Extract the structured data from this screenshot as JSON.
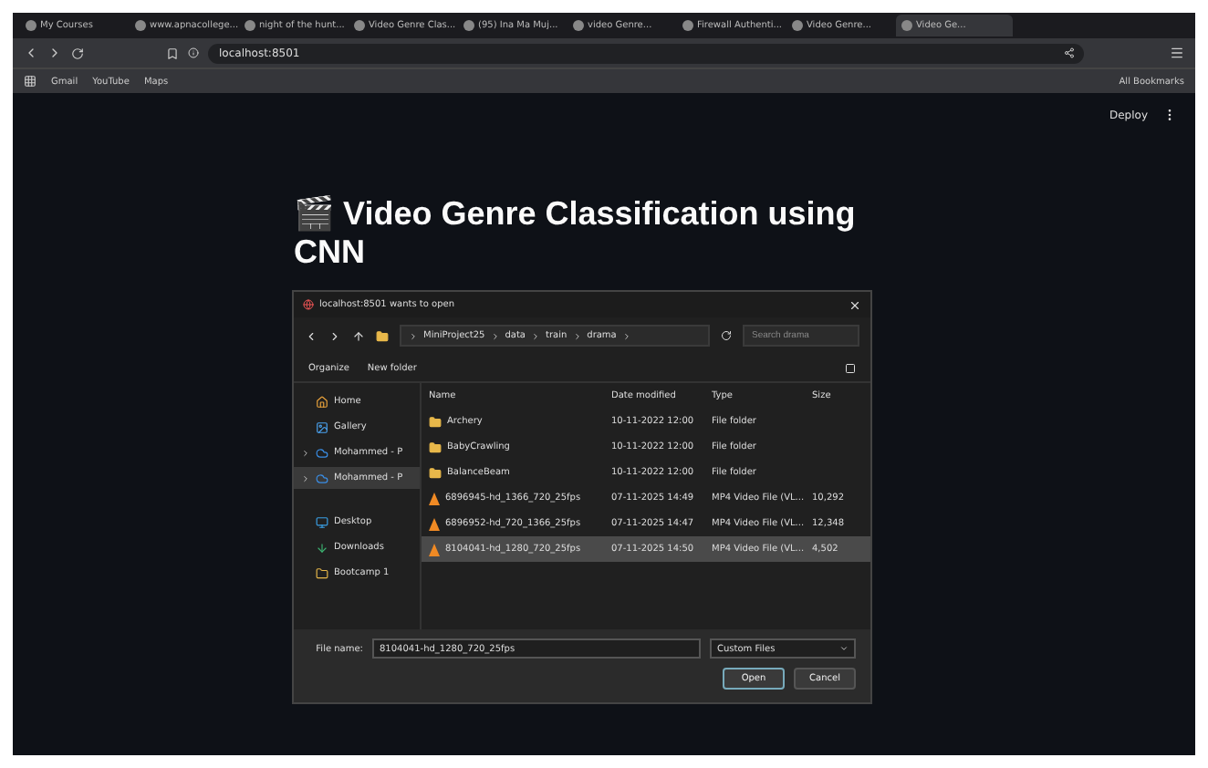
{
  "browser": {
    "tabs": [
      {
        "label": "My Courses",
        "selected": false
      },
      {
        "label": "www.apnacollege...",
        "selected": false
      },
      {
        "label": "night of the hunt...",
        "selected": false
      },
      {
        "label": "Video Genre Clas...",
        "selected": false
      },
      {
        "label": "(95) Ina Ma Muj...",
        "selected": false
      },
      {
        "label": "video Genre...",
        "selected": false
      },
      {
        "label": "Firewall Authenti...",
        "selected": false
      },
      {
        "label": "Video Genre...",
        "selected": false
      },
      {
        "label": "Video Ge...",
        "selected": true
      }
    ],
    "address": "localhost:8501",
    "bookmarks": [
      "Gmail",
      "YouTube",
      "Maps"
    ],
    "all_bookmarks": "All Bookmarks"
  },
  "app": {
    "deploy": "Deploy",
    "title_icon": "🎬",
    "title": "Video Genre Classification using CNN"
  },
  "dialog": {
    "title": "localhost:8501 wants to open",
    "path": [
      "MiniProject25",
      "data",
      "train",
      "drama"
    ],
    "search": {
      "placeholder": "Search drama"
    },
    "organize": "Organize",
    "new_folder": "New folder",
    "sidebar": [
      {
        "label": "Home",
        "kind": "home",
        "expandable": false,
        "selected": false
      },
      {
        "label": "Gallery",
        "kind": "gallery",
        "expandable": false,
        "selected": false
      },
      {
        "label": "Mohammed - P",
        "kind": "cloud",
        "expandable": true,
        "selected": false
      },
      {
        "label": "Mohammed - P",
        "kind": "cloud",
        "expandable": true,
        "selected": true
      },
      {
        "label": "Desktop",
        "kind": "desktop",
        "expandable": false,
        "selected": false
      },
      {
        "label": "Downloads",
        "kind": "download",
        "expandable": false,
        "selected": false
      },
      {
        "label": "Bootcamp 1",
        "kind": "folder",
        "expandable": false,
        "selected": false
      }
    ],
    "columns": [
      "Name",
      "Date modified",
      "Type",
      "Size"
    ],
    "files": [
      {
        "kind": "folder",
        "name": "Archery",
        "date": "10-11-2022 12:00",
        "type": "File folder",
        "selected": false
      },
      {
        "kind": "folder",
        "name": "BabyCrawling",
        "date": "10-11-2022 12:00",
        "type": "File folder",
        "selected": false
      },
      {
        "kind": "folder",
        "name": "BalanceBeam",
        "date": "10-11-2022 12:00",
        "type": "File folder",
        "selected": false
      },
      {
        "kind": "video",
        "name": "6896945-hd_1366_720_25fps",
        "date": "07-11-2025 14:49",
        "type": "MP4 Video File (VL...",
        "size": "10,292",
        "selected": false
      },
      {
        "kind": "video",
        "name": "6896952-hd_720_1366_25fps",
        "date": "07-11-2025 14:47",
        "type": "MP4 Video File (VL...",
        "size": "12,348",
        "selected": false
      },
      {
        "kind": "video",
        "name": "8104041-hd_1280_720_25fps",
        "date": "07-11-2025 14:50",
        "type": "MP4 Video File (VL...",
        "size": "4,502",
        "selected": true
      }
    ],
    "file_name_label": "File name:",
    "file_name": "8104041-hd_1280_720_25fps",
    "filter": "Custom Files",
    "open": "Open",
    "cancel": "Cancel"
  }
}
